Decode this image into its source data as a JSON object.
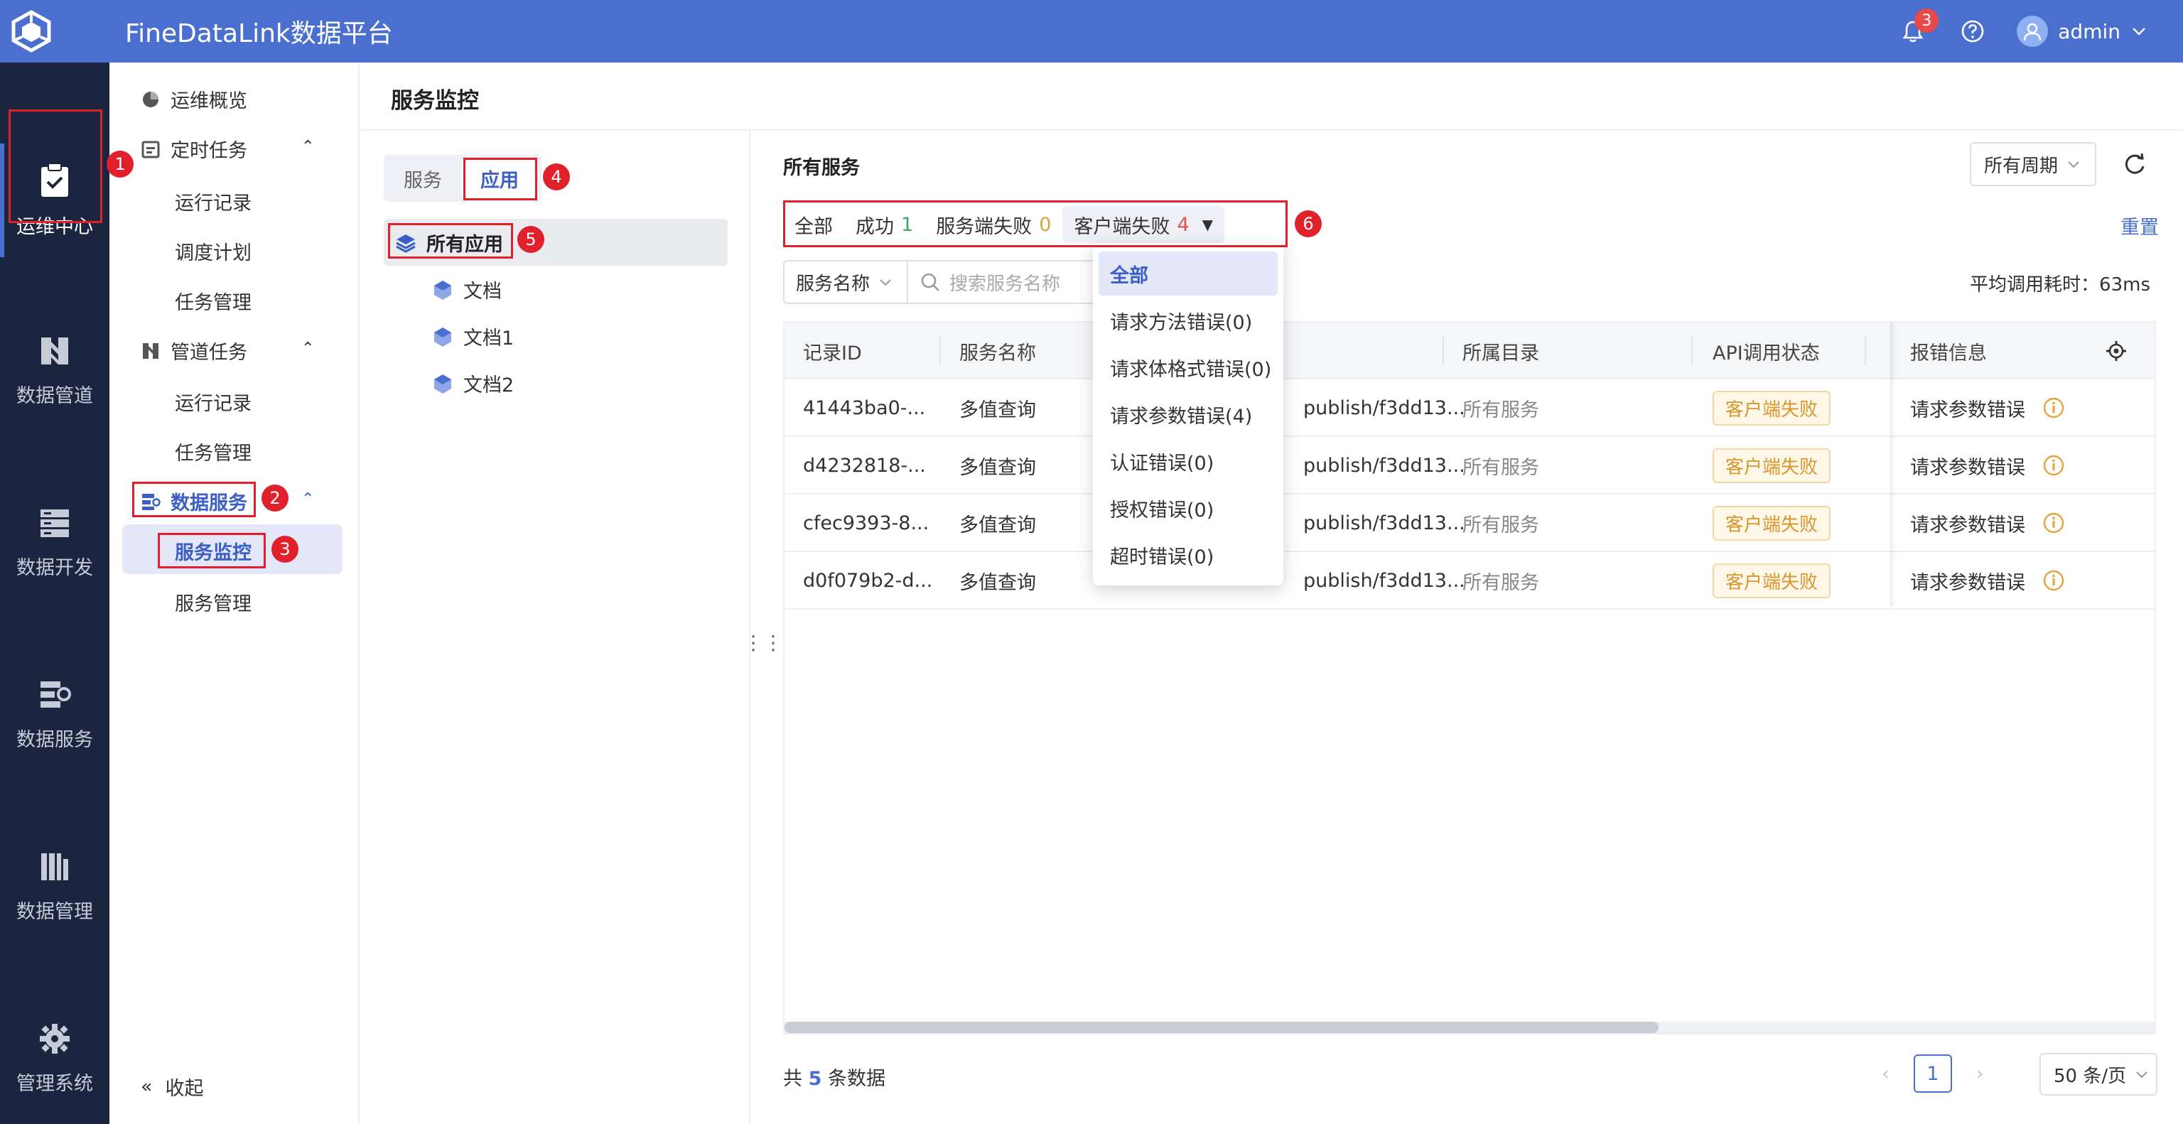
{
  "header": {
    "title": "FineDataLink数据平台",
    "notification_count": "3",
    "username": "admin"
  },
  "rail": [
    {
      "label": "运维中心",
      "icon": "clipboard-check-icon"
    },
    {
      "label": "数据管道",
      "icon": "pipeline-icon"
    },
    {
      "label": "数据开发",
      "icon": "server-icon"
    },
    {
      "label": "数据服务",
      "icon": "service-icon"
    },
    {
      "label": "数据管理",
      "icon": "library-icon"
    },
    {
      "label": "管理系统",
      "icon": "gear-icon"
    }
  ],
  "nav": {
    "overview": "运维概览",
    "scheduled": "定时任务",
    "run_record_1": "运行记录",
    "schedule_plan": "调度计划",
    "task_mgmt_1": "任务管理",
    "pipeline": "管道任务",
    "run_record_2": "运行记录",
    "task_mgmt_2": "任务管理",
    "data_service": "数据服务",
    "service_monitor": "服务监控",
    "service_mgmt": "服务管理",
    "collapse": "收起"
  },
  "page_title": "服务监控",
  "tree": {
    "tabs": [
      "服务",
      "应用"
    ],
    "root": "所有应用",
    "children": [
      "文档",
      "文档1",
      "文档2"
    ]
  },
  "main": {
    "section_title": "所有服务",
    "period": "所有周期",
    "filters": {
      "all": "全部",
      "success_label": "成功",
      "success_count": "1",
      "server_fail_label": "服务端失败",
      "server_fail_count": "0",
      "client_fail_label": "客户端失败",
      "client_fail_count": "4"
    },
    "reset": "重置",
    "search_field": "服务名称",
    "search_placeholder": "搜索服务名称",
    "avg_time": "平均调用耗时：63ms",
    "columns": [
      "记录ID",
      "服务名称",
      "所属目录",
      "API调用状态",
      "报错信息"
    ],
    "rows": [
      {
        "id": "41443ba0-...",
        "name": "多值查询",
        "path": "publish/f3dd13...",
        "catalog": "所有服务",
        "status": "客户端失败",
        "error": "请求参数错误"
      },
      {
        "id": "d4232818-...",
        "name": "多值查询",
        "path": "publish/f3dd13...",
        "catalog": "所有服务",
        "status": "客户端失败",
        "error": "请求参数错误"
      },
      {
        "id": "cfec9393-8...",
        "name": "多值查询",
        "path": "publish/f3dd13...",
        "catalog": "所有服务",
        "status": "客户端失败",
        "error": "请求参数错误"
      },
      {
        "id": "d0f079b2-d...",
        "name": "多值查询",
        "path": "publish/f3dd13...",
        "catalog": "所有服务",
        "status": "客户端失败",
        "error": "请求参数错误"
      }
    ],
    "total_prefix": "共",
    "total_count": "5",
    "total_suffix": "条数据",
    "current_page": "1",
    "page_size": "50 条/页"
  },
  "dropdown": [
    "全部",
    "请求方法错误(0)",
    "请求体格式错误(0)",
    "请求参数错误(4)",
    "认证错误(0)",
    "授权错误(0)",
    "超时错误(0)"
  ],
  "markers": [
    "1",
    "2",
    "3",
    "4",
    "5",
    "6"
  ],
  "colors": {
    "accent": "#4a6fcf",
    "rail_bg": "#1c2540",
    "annotation": "#e0202a",
    "warning": "#d9962b"
  }
}
